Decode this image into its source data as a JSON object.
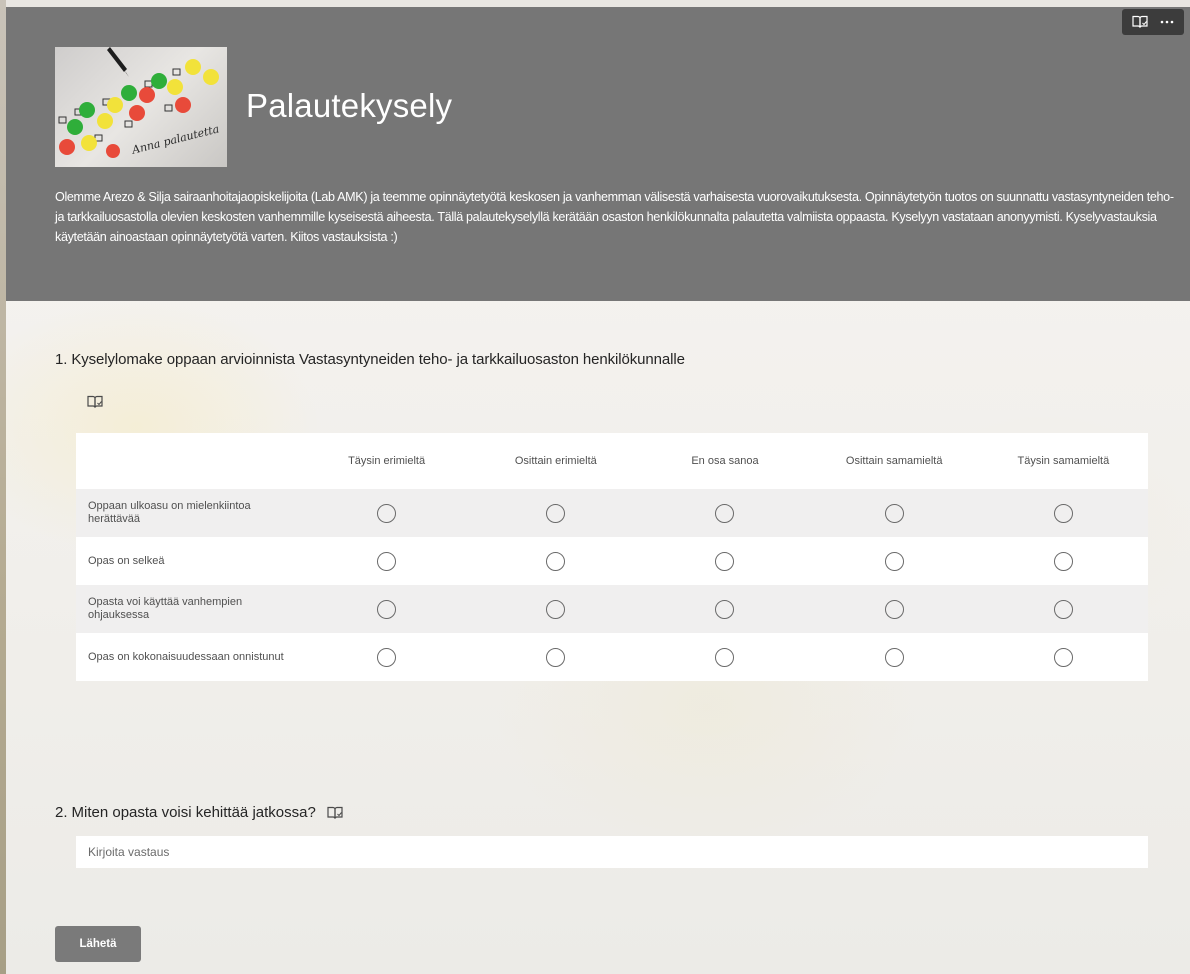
{
  "header": {
    "title": "Palautekysely",
    "description": "Olemme Arezo & Silja sairaanhoitajaopiskelijoita (Lab AMK) ja teemme opinnäytetyötä keskosen ja vanhemman välisestä varhaisesta vuorovaikutuksesta. Opinnäytetyön tuotos on suunnattu vastasyntyneiden teho- ja tarkkailuosastolla olevien  keskosten vanhemmille kyseisestä aiheesta. Tällä palautekyselyllä kerätään osaston henkilökunnalta palautetta valmiista oppaasta. Kyselyyn vastataan anonyymisti. Kyselyvastauksia käytetään ainoastaan opinnäytetyötä varten. Kiitos vastauksista :)",
    "logo_text": "Anna palautetta",
    "logo_signature": "Anna palautetta"
  },
  "question1": {
    "number": "1.",
    "title": "Kyselylomake oppaan arvioinnista  Vastasyntyneiden teho- ja tarkkailuosaston henkilökunnalle",
    "columns": [
      "Täysin erimieltä",
      "Osittain erimieltä",
      "En osa sanoa",
      "Osittain samamieltä",
      "Täysin samamieltä"
    ],
    "rows": [
      "Oppaan ulkoasu on mielenkiintoa herättävää",
      "Opas on selkeä",
      "Opasta voi käyttää vanhempien ohjauksessa",
      " Opas on kokonaisuudessaan onnistunut"
    ]
  },
  "question2": {
    "number": "2.",
    "title": "Miten opasta voisi kehittää jatkossa?",
    "placeholder": "Kirjoita vastaus"
  },
  "submit_label": "Lähetä",
  "icons": {
    "immersive_reader": "immersive-reader-icon",
    "more": "more-options-icon"
  }
}
